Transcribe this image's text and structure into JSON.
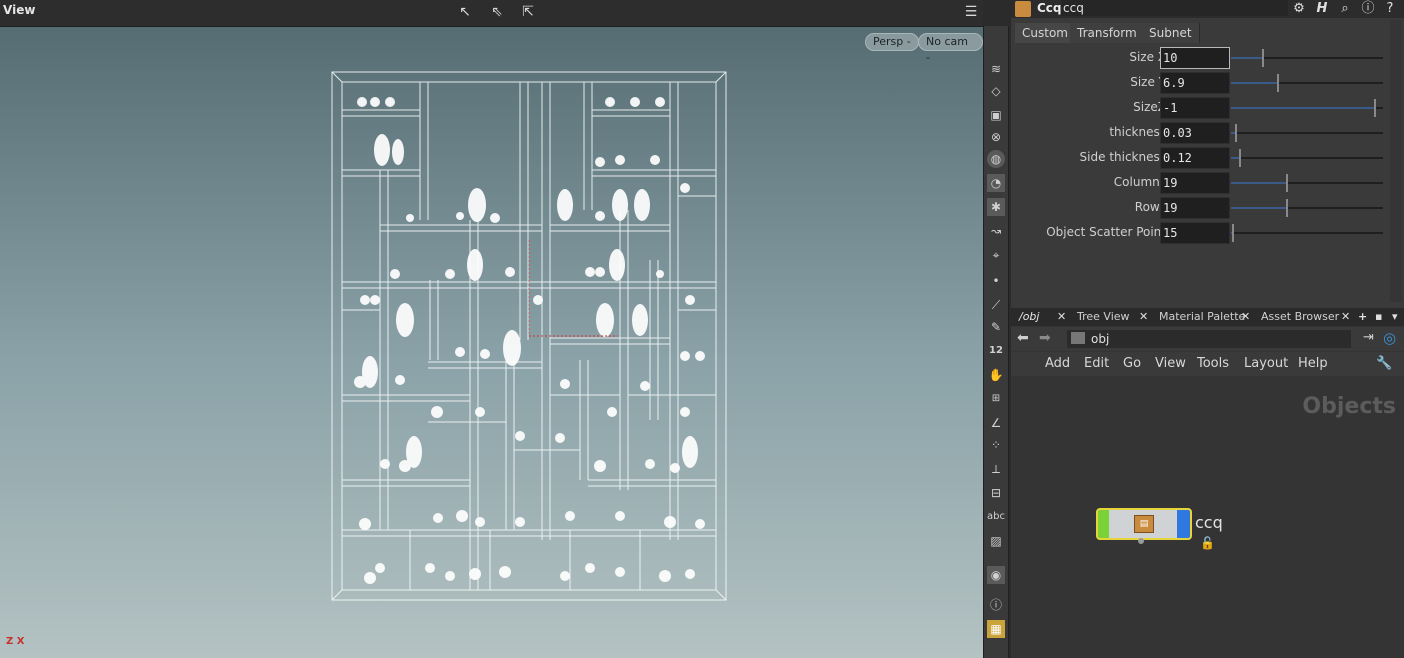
{
  "viewport": {
    "title": "View",
    "persp_label": "Persp -",
    "cam_label": "No cam -",
    "axis_label": "Z X"
  },
  "params": {
    "node_type": "Ccq",
    "node_name": "ccq",
    "tabs": [
      "Custom",
      "Transform",
      "Subnet"
    ],
    "rows": [
      {
        "label": "Size X",
        "value": "10",
        "level": 0.21
      },
      {
        "label": "Size Y",
        "value": "6.9",
        "level": 0.31
      },
      {
        "label": "SizeZ",
        "value": "-1",
        "level": 0.95
      },
      {
        "label": "thickness",
        "value": "0.03",
        "level": 0.03
      },
      {
        "label": "Side thickness",
        "value": "0.12",
        "level": 0.06
      },
      {
        "label": "Columns",
        "value": "19",
        "level": 0.37
      },
      {
        "label": "Rows",
        "value": "19",
        "level": 0.37
      },
      {
        "label": "Object Scatter Point",
        "value": "15",
        "level": 0.01
      }
    ]
  },
  "network": {
    "tabs": [
      "/obj",
      "Tree View",
      "Material Palette",
      "Asset Browser"
    ],
    "path": "obj",
    "menu": [
      "Add",
      "Edit",
      "Go",
      "View",
      "Tools",
      "Layout",
      "Help"
    ],
    "context_label": "Objects",
    "node_label": "ccq"
  },
  "colors": {
    "node_green": "#7ad238",
    "node_blue": "#2f78e0",
    "node_select": "#e7d33a"
  }
}
